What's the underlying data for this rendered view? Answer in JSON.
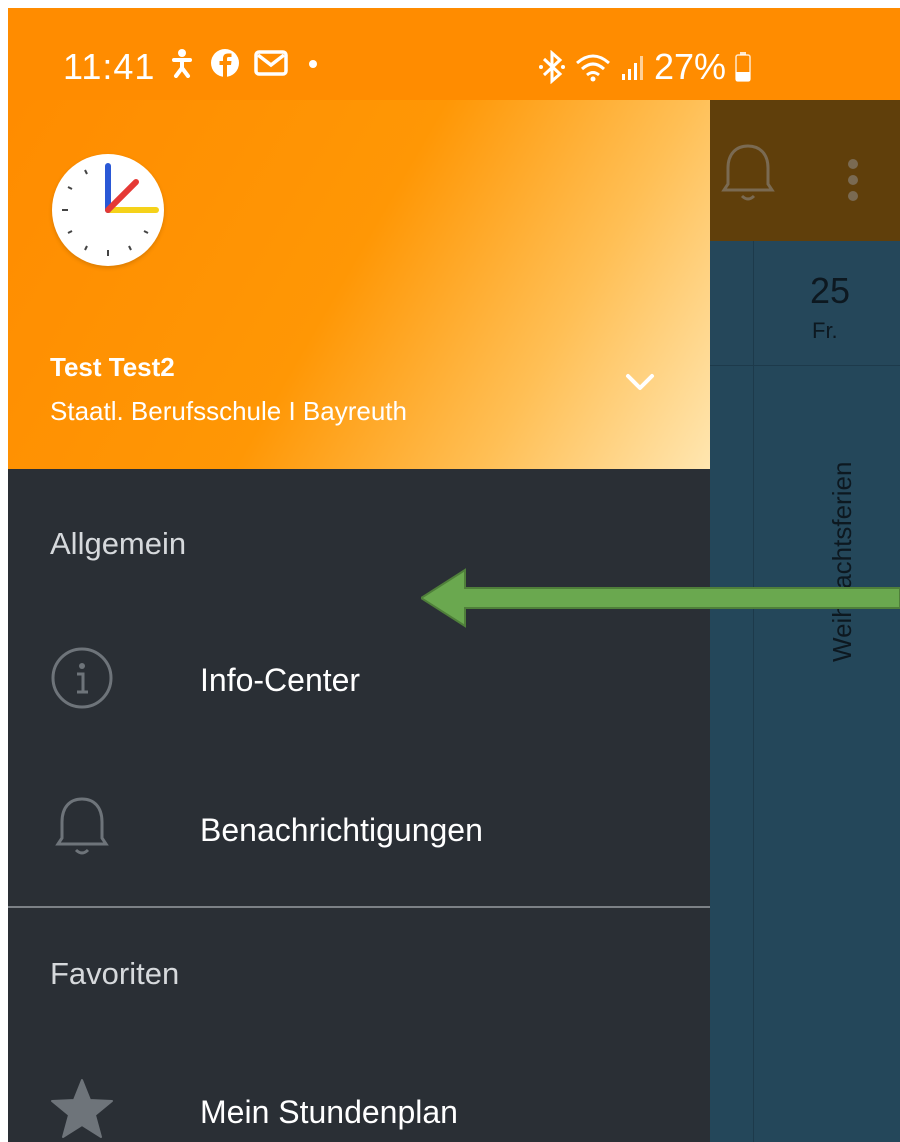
{
  "status_bar": {
    "time": "11:41",
    "battery": "27%"
  },
  "background_app": {
    "day_number": "25",
    "day_name": "Fr.",
    "event_label": "Weihnachtsferien"
  },
  "drawer": {
    "user_name": "Test Test2",
    "school_name": "Staatl. Berufsschule I Bayreuth",
    "section_general": "Allgemein",
    "section_favorites": "Favoriten",
    "items": [
      {
        "label": "Info-Center",
        "icon": "info-icon"
      },
      {
        "label": "Benachrichtigungen",
        "icon": "bell-icon"
      },
      {
        "label": "Mein Stundenplan",
        "icon": "star-icon"
      }
    ]
  },
  "colors": {
    "header_orange": "#ff8c00",
    "drawer_bg": "#2a2f35",
    "annotation_arrow": "#6aa84f"
  }
}
